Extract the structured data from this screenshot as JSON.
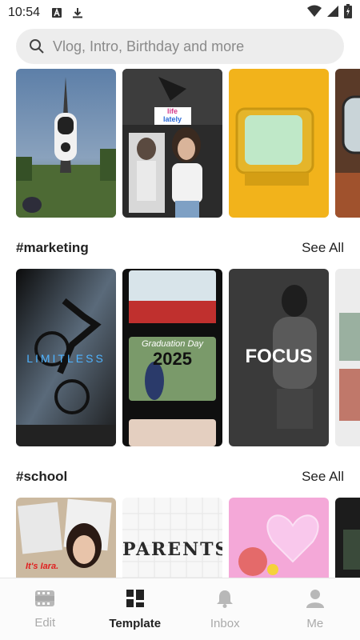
{
  "status_bar": {
    "time": "10:54"
  },
  "search": {
    "placeholder": "Vlog, Intro, Birthday and more"
  },
  "sections": [
    {
      "tag": "#marketing",
      "see_all": "See All",
      "overlay_texts": [
        "LIMITLESS",
        "Graduation Day",
        "2025",
        "FOCUS"
      ]
    },
    {
      "tag": "#school",
      "see_all": "See All",
      "overlay_texts": [
        "It's Iara.",
        "PARENTS"
      ]
    }
  ],
  "top_row": {
    "overlay_texts": [
      "life",
      "lately"
    ]
  },
  "bottom_nav": {
    "items": [
      {
        "label": "Edit",
        "icon": "film-icon",
        "active": false
      },
      {
        "label": "Template",
        "icon": "grid-icon",
        "active": true
      },
      {
        "label": "Inbox",
        "icon": "bell-icon",
        "active": false
      },
      {
        "label": "Me",
        "icon": "user-icon",
        "active": false
      }
    ]
  },
  "colors": {
    "accent_yellow": "#f2b31b",
    "search_bg": "#ededed",
    "nav_active": "#222222",
    "nav_inactive": "#aaaaaa"
  }
}
